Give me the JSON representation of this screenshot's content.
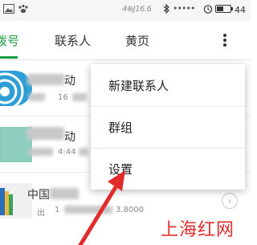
{
  "status_bar": {
    "center_text": "4⊕J16.6",
    "dots": "•••••",
    "battery_level": "44"
  },
  "tabs": [
    {
      "label": "拨号",
      "active": true
    },
    {
      "label": "联系人",
      "active": false
    },
    {
      "label": "黄页",
      "active": false
    }
  ],
  "list": [
    {
      "name_tail": "动",
      "meta": "16"
    },
    {
      "name_tail": "动",
      "meta": "4:44"
    },
    {
      "name_prefix": "中国",
      "meta_left": "出",
      "meta_mid": "1",
      "meta_right": "3.8000"
    }
  ],
  "menu": {
    "items": [
      {
        "label": "新建联系人"
      },
      {
        "label": "群组"
      },
      {
        "label": "设置"
      }
    ]
  },
  "watermark": "上海红网",
  "colors": {
    "accent_green": "#1a9e3f",
    "arrow_red": "#e22b2b"
  }
}
